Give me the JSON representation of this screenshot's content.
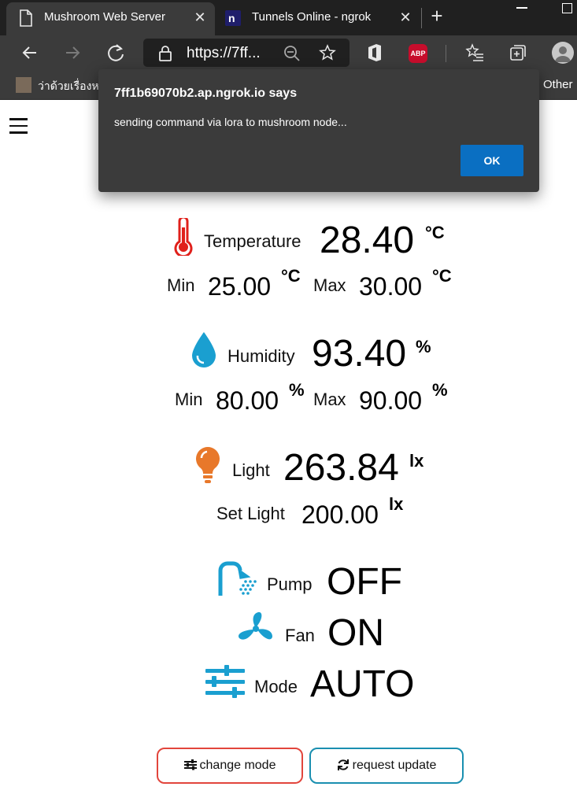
{
  "browser": {
    "tabs": [
      {
        "title": "Mushroom Web Server",
        "active": true
      },
      {
        "title": "Tunnels Online - ngrok",
        "active": false
      }
    ],
    "address": "https://7ff...",
    "favorites": {
      "first_label": "ว่าด้วยเรื่องหน",
      "other_label": "Other"
    },
    "abp_label": "ABP"
  },
  "dialog": {
    "title": "7ff1b69070b2.ap.ngrok.io says",
    "message": "sending command via lora to mushroom node...",
    "ok_label": "OK"
  },
  "temperature": {
    "label": "Temperature",
    "value": "28.40",
    "unit": "°C",
    "min_label": "Min",
    "min": "25.00",
    "max_label": "Max",
    "max": "30.00",
    "color": "#e0201b"
  },
  "humidity": {
    "label": "Humidity",
    "value": "93.40",
    "unit": "%",
    "min_label": "Min",
    "min": "80.00",
    "max_label": "Max",
    "max": "90.00",
    "color": "#1a9fd0"
  },
  "light": {
    "label": "Light",
    "value": "263.84",
    "unit": "lx",
    "set_label": "Set Light",
    "set_value": "200.00",
    "color": "#e8782a"
  },
  "pump": {
    "label": "Pump",
    "state": "OFF"
  },
  "fan": {
    "label": "Fan",
    "state": "ON"
  },
  "mode": {
    "label": "Mode",
    "state": "AUTO"
  },
  "icon_color": "#1a9fd0",
  "buttons": {
    "change_mode": "change mode",
    "request_update": "request update"
  }
}
